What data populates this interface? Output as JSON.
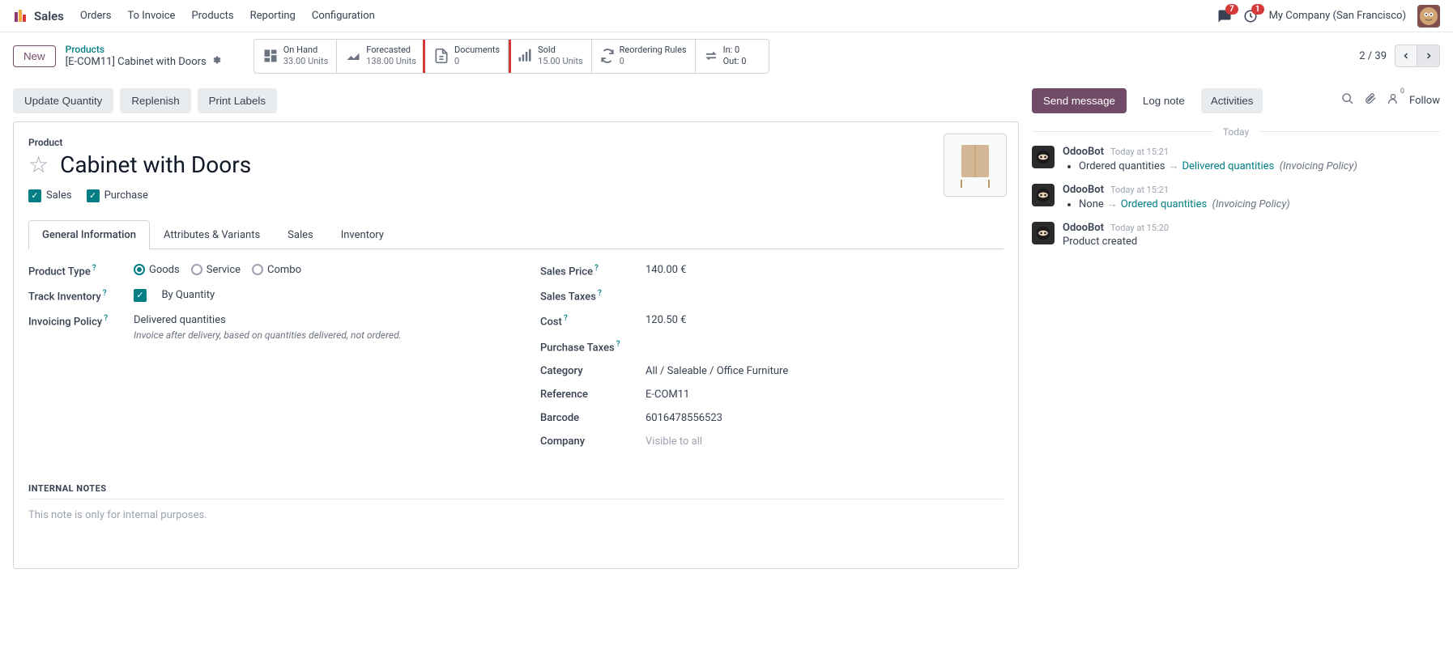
{
  "topnav": {
    "brand": "Sales",
    "menu": [
      "Orders",
      "To Invoice",
      "Products",
      "Reporting",
      "Configuration"
    ],
    "chat_badge": "7",
    "clock_badge": "1",
    "company": "My Company (San Francisco)"
  },
  "subhead": {
    "new_btn": "New",
    "breadcrumb_top": "Products",
    "breadcrumb_item": "[E-COM11] Cabinet with Doors",
    "pager": "2 / 39"
  },
  "stats": [
    {
      "label": "On Hand",
      "value": "33.00 Units"
    },
    {
      "label": "Forecasted",
      "value": "138.00 Units"
    },
    {
      "label": "Documents",
      "value": "0"
    },
    {
      "label": "Sold",
      "value": "15.00 Units"
    },
    {
      "label": "Reordering Rules",
      "value": "0"
    },
    {
      "label_a": "In: 0",
      "label_b": "Out: 0"
    }
  ],
  "actions": {
    "update_qty": "Update Quantity",
    "replenish": "Replenish",
    "print_labels": "Print Labels"
  },
  "product": {
    "label": "Product",
    "name": "Cabinet with Doors",
    "sales_check": "Sales",
    "purchase_check": "Purchase"
  },
  "tabs": [
    "General Information",
    "Attributes & Variants",
    "Sales",
    "Inventory"
  ],
  "form": {
    "product_type_label": "Product Type",
    "goods": "Goods",
    "service": "Service",
    "combo": "Combo",
    "track_inv_label": "Track Inventory",
    "by_qty": "By Quantity",
    "invoicing_label": "Invoicing Policy",
    "invoicing_value": "Delivered quantities",
    "invoicing_note": "Invoice after delivery, based on quantities delivered, not ordered.",
    "sales_price_label": "Sales Price",
    "sales_price": "140.00 €",
    "sales_taxes_label": "Sales Taxes",
    "cost_label": "Cost",
    "cost": "120.50 €",
    "purchase_taxes_label": "Purchase Taxes",
    "category_label": "Category",
    "category": "All / Saleable / Office Furniture",
    "reference_label": "Reference",
    "reference": "E-COM11",
    "barcode_label": "Barcode",
    "barcode": "6016478556523",
    "company_label": "Company",
    "company_val": "Visible to all"
  },
  "internal_notes": {
    "title": "INTERNAL NOTES",
    "placeholder": "This note is only for internal purposes."
  },
  "chatter": {
    "send": "Send message",
    "log": "Log note",
    "activities": "Activities",
    "follow": "Follow",
    "follower_count": "0",
    "today": "Today",
    "entries": [
      {
        "user": "OdooBot",
        "time": "Today at 15:21",
        "before": "Ordered quantities",
        "after": "Delivered quantities",
        "field": "(Invoicing Policy)"
      },
      {
        "user": "OdooBot",
        "time": "Today at 15:21",
        "before": "None",
        "after": "Ordered quantities",
        "field": "(Invoicing Policy)"
      },
      {
        "user": "OdooBot",
        "time": "Today at 15:20",
        "text": "Product created"
      }
    ]
  }
}
